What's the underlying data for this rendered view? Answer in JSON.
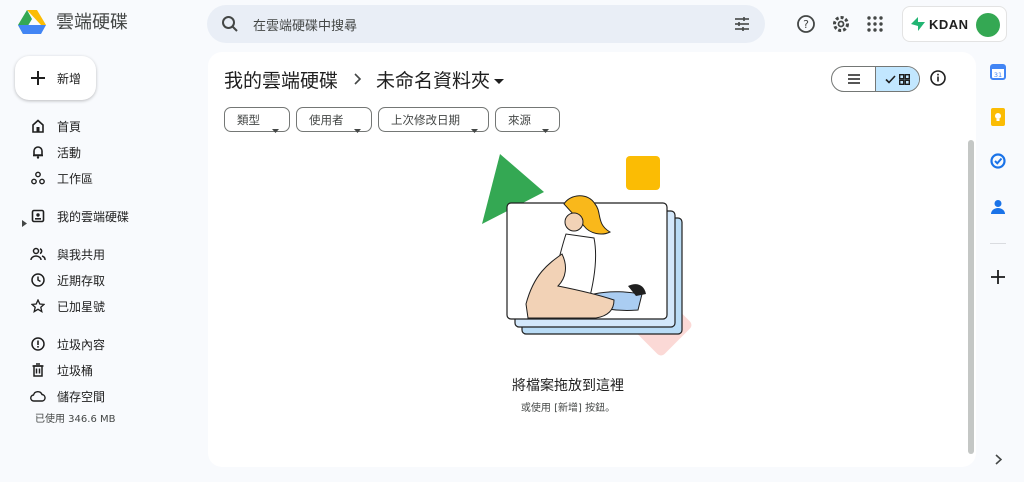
{
  "app": {
    "title": "雲端硬碟"
  },
  "search": {
    "placeholder": "在雲端硬碟中搜尋"
  },
  "account": {
    "brand": "KDAN"
  },
  "sidebar": {
    "new_label": "新增",
    "items": [
      {
        "label": "首頁",
        "icon": "home-icon"
      },
      {
        "label": "活動",
        "icon": "bell-icon"
      },
      {
        "label": "工作區",
        "icon": "workspaces-icon"
      },
      {
        "label": "我的雲端硬碟",
        "icon": "my-drive-icon"
      },
      {
        "label": "與我共用",
        "icon": "shared-users-icon"
      },
      {
        "label": "近期存取",
        "icon": "clock-icon"
      },
      {
        "label": "已加星號",
        "icon": "star-icon"
      },
      {
        "label": "垃圾內容",
        "icon": "spam-icon"
      },
      {
        "label": "垃圾桶",
        "icon": "trash-icon"
      },
      {
        "label": "儲存空間",
        "icon": "cloud-icon"
      }
    ],
    "storage_used": "已使用 346.6 MB"
  },
  "breadcrumb": {
    "root": "我的雲端硬碟",
    "current": "未命名資料夾"
  },
  "filters": [
    "類型",
    "使用者",
    "上次修改日期",
    "來源"
  ],
  "empty_state": {
    "title": "將檔案拖放到這裡",
    "subtitle": "或使用 [新增] 按鈕。"
  },
  "colors": {
    "accent": "#0b57d0",
    "selected_toggle": "#c2e7ff",
    "background": "#f8fafd"
  }
}
